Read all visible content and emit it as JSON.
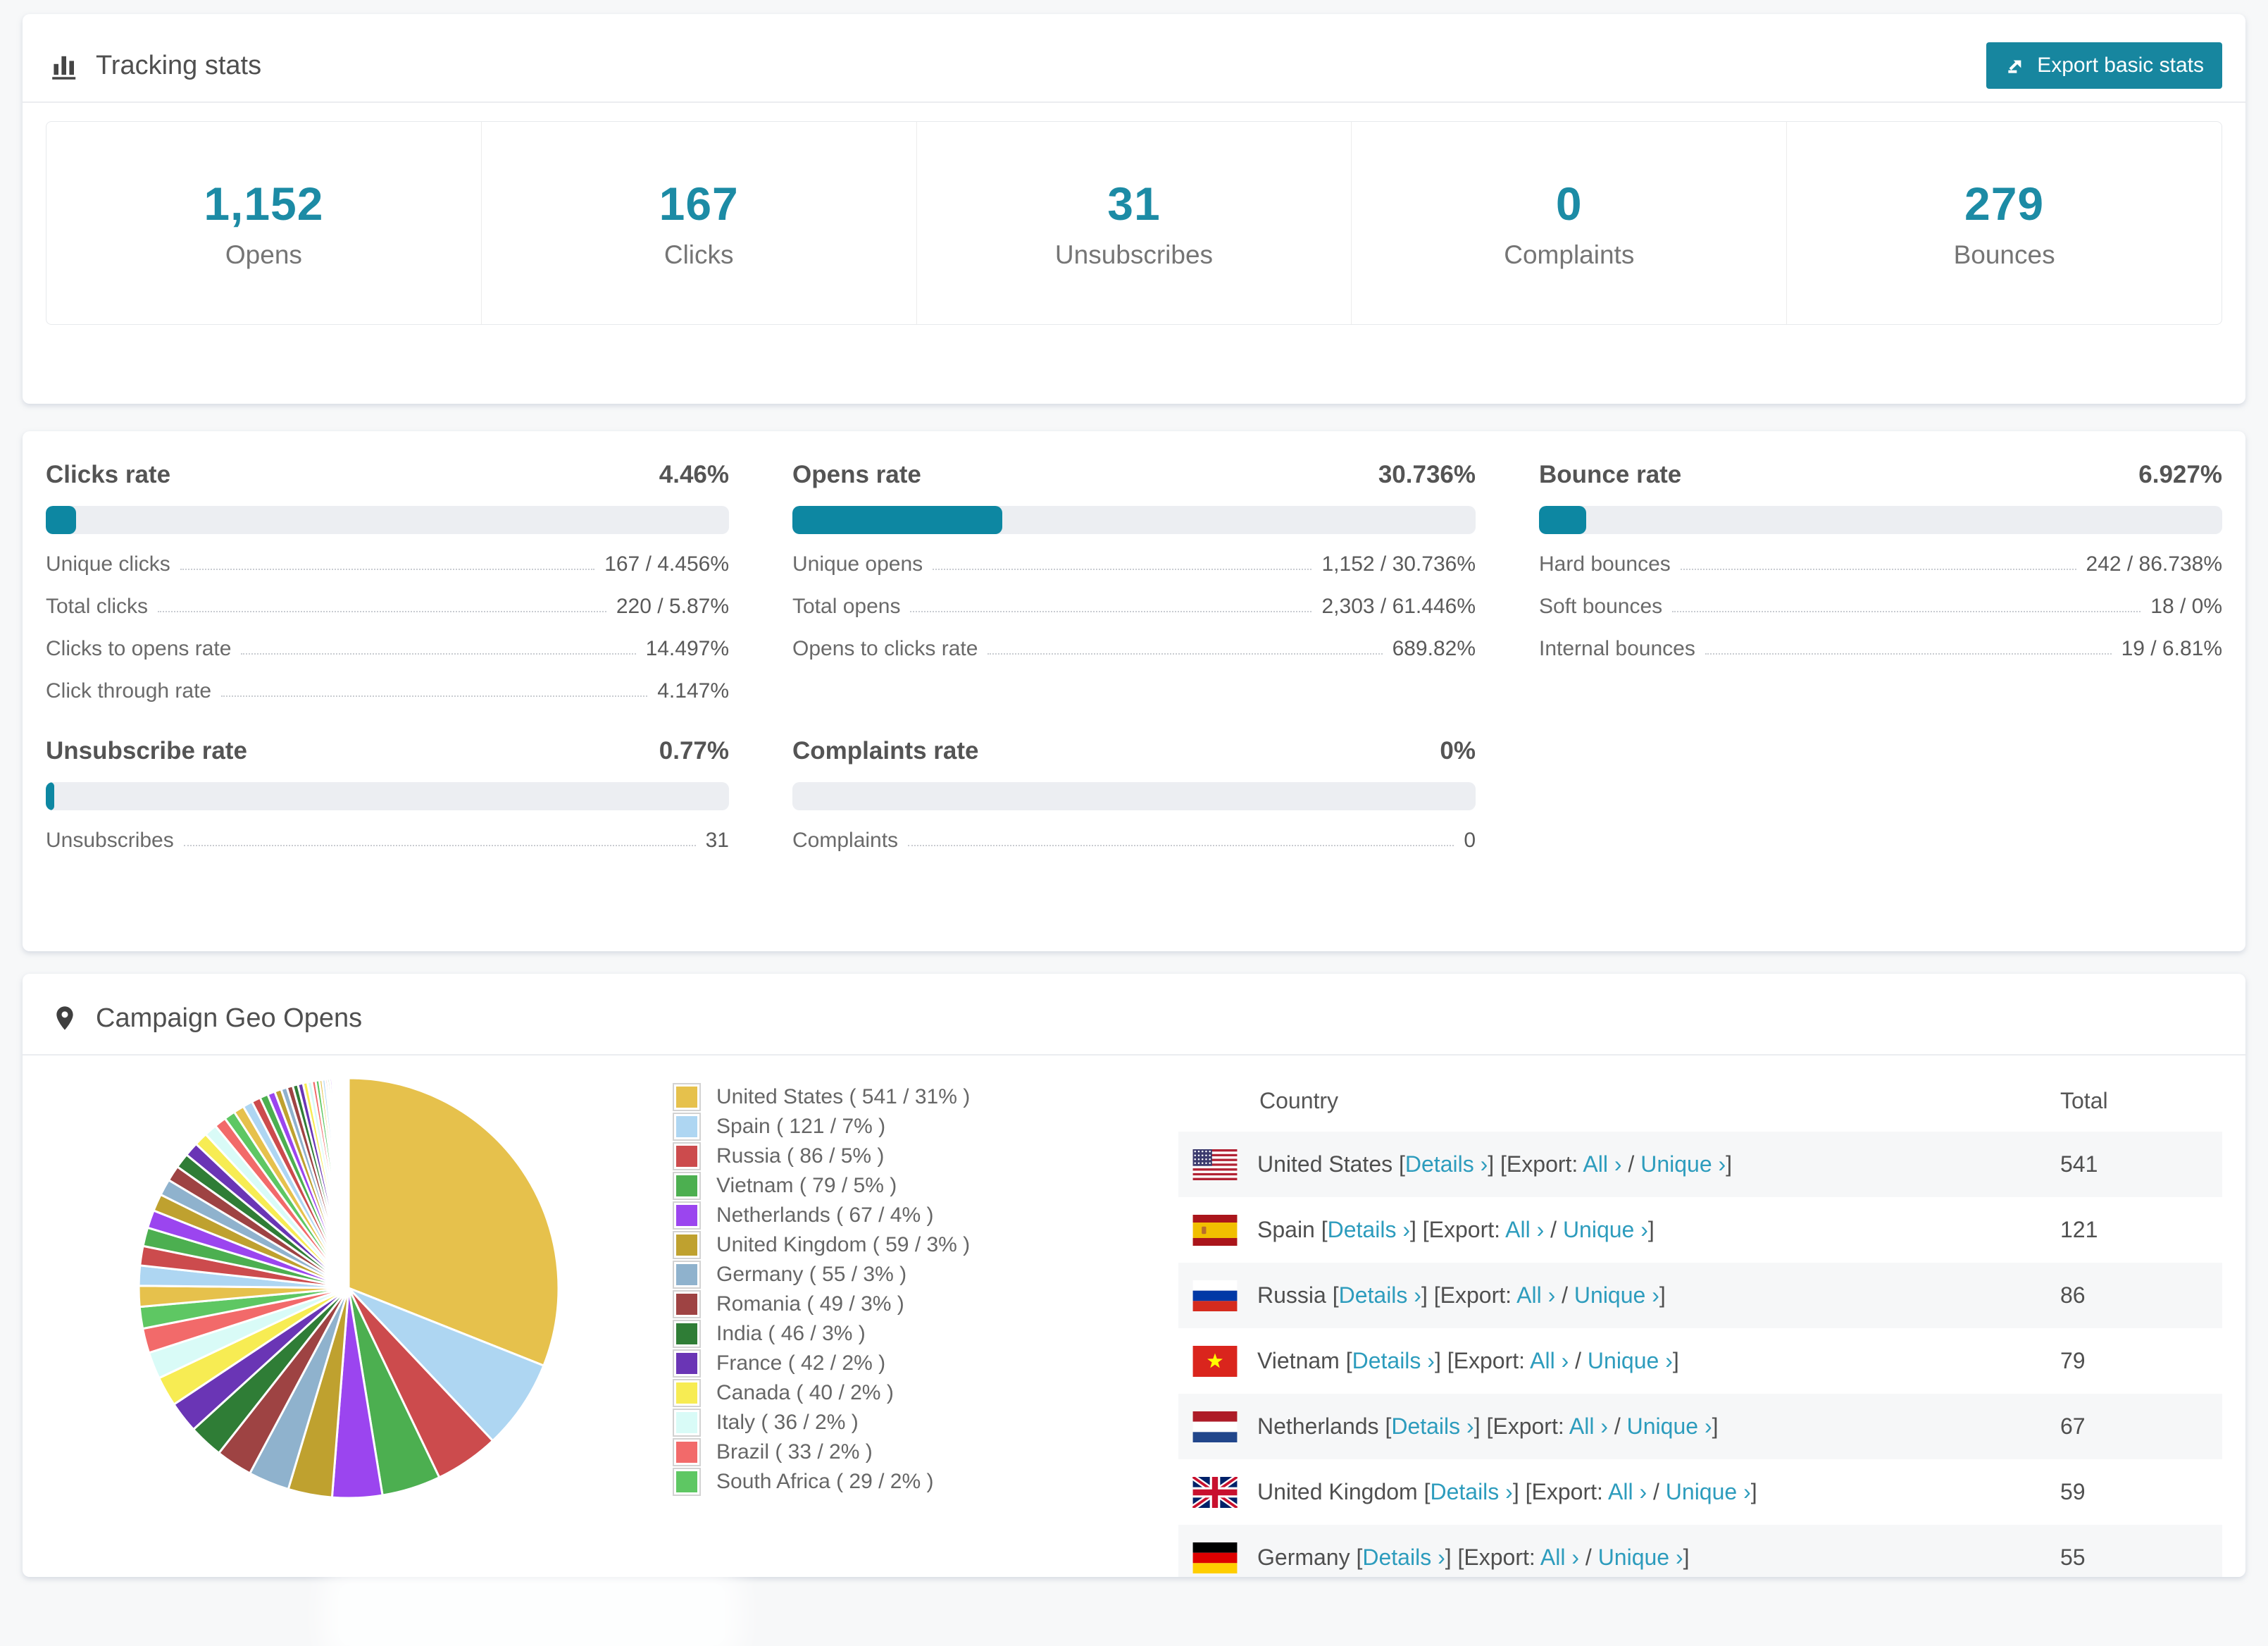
{
  "colors": {
    "accent_button": "#17869f",
    "accent_number": "#1c8ba5",
    "progress_fill": "#0d87a2",
    "progress_track": "#eceef2",
    "link": "#2d9cbd",
    "row_stripe": "#f6f7f8"
  },
  "tracking_stats": {
    "title": "Tracking stats",
    "export_button_label": "Export basic stats",
    "stats": [
      {
        "value": "1,152",
        "label": "Opens"
      },
      {
        "value": "167",
        "label": "Clicks"
      },
      {
        "value": "31",
        "label": "Unsubscribes"
      },
      {
        "value": "0",
        "label": "Complaints"
      },
      {
        "value": "279",
        "label": "Bounces"
      }
    ]
  },
  "rates": {
    "blocks": [
      {
        "title": "Clicks rate",
        "value": "4.46%",
        "percent": 4.46,
        "rows": [
          {
            "label": "Unique clicks",
            "value": "167 / 4.456%"
          },
          {
            "label": "Total clicks",
            "value": "220 / 5.87%"
          },
          {
            "label": "Clicks to opens rate",
            "value": "14.497%"
          },
          {
            "label": "Click through rate",
            "value": "4.147%"
          }
        ]
      },
      {
        "title": "Opens rate",
        "value": "30.736%",
        "percent": 30.736,
        "rows": [
          {
            "label": "Unique opens",
            "value": "1,152 / 30.736%"
          },
          {
            "label": "Total opens",
            "value": "2,303 / 61.446%"
          },
          {
            "label": "Opens to clicks rate",
            "value": "689.82%"
          }
        ]
      },
      {
        "title": "Bounce rate",
        "value": "6.927%",
        "percent": 6.927,
        "rows": [
          {
            "label": "Hard bounces",
            "value": "242 / 86.738%"
          },
          {
            "label": "Soft bounces",
            "value": "18 / 0%"
          },
          {
            "label": "Internal bounces",
            "value": "19 / 6.81%"
          }
        ]
      },
      {
        "title": "Unsubscribe rate",
        "value": "0.77%",
        "percent": 0.77,
        "rows": [
          {
            "label": "Unsubscribes",
            "value": "31"
          }
        ]
      },
      {
        "title": "Complaints rate",
        "value": "0%",
        "percent": 0,
        "rows": [
          {
            "label": "Complaints",
            "value": "0"
          }
        ]
      }
    ]
  },
  "geo": {
    "title": "Campaign Geo Opens",
    "link_labels": {
      "details": "Details ›",
      "export_prefix": "Export:",
      "all": "All ›",
      "unique": "Unique ›"
    },
    "table": {
      "headers": [
        "Country",
        "Total"
      ],
      "rows": [
        {
          "flag": "us",
          "country": "United States",
          "total": "541"
        },
        {
          "flag": "es",
          "country": "Spain",
          "total": "121"
        },
        {
          "flag": "ru",
          "country": "Russia",
          "total": "86"
        },
        {
          "flag": "vn",
          "country": "Vietnam",
          "total": "79"
        },
        {
          "flag": "nl",
          "country": "Netherlands",
          "total": "67"
        },
        {
          "flag": "gb",
          "country": "United Kingdom",
          "total": "59"
        },
        {
          "flag": "de",
          "country": "Germany",
          "total": "55"
        }
      ]
    }
  },
  "chart_data": {
    "type": "pie",
    "title": "Campaign Geo Opens",
    "legend_position": "right",
    "start_angle_deg": -90,
    "direction": "clockwise",
    "series": [
      {
        "name": "United States",
        "value": 541,
        "pct": 31,
        "color": "#e6c14c"
      },
      {
        "name": "Spain",
        "value": 121,
        "pct": 7,
        "color": "#aed6f2"
      },
      {
        "name": "Russia",
        "value": 86,
        "pct": 5,
        "color": "#cc4b4d"
      },
      {
        "name": "Vietnam",
        "value": 79,
        "pct": 5,
        "color": "#4caf50"
      },
      {
        "name": "Netherlands",
        "value": 67,
        "pct": 4,
        "color": "#9b45ef"
      },
      {
        "name": "United Kingdom",
        "value": 59,
        "pct": 3,
        "color": "#bfa12f"
      },
      {
        "name": "Germany",
        "value": 55,
        "pct": 3,
        "color": "#8fb2cd"
      },
      {
        "name": "Romania",
        "value": 49,
        "pct": 3,
        "color": "#9e4343"
      },
      {
        "name": "India",
        "value": 46,
        "pct": 3,
        "color": "#2f7d36"
      },
      {
        "name": "France",
        "value": 42,
        "pct": 2,
        "color": "#6a35b5"
      },
      {
        "name": "Canada",
        "value": 40,
        "pct": 2,
        "color": "#f7ec53"
      },
      {
        "name": "Italy",
        "value": 36,
        "pct": 2,
        "color": "#d9fbf7"
      },
      {
        "name": "Brazil",
        "value": 33,
        "pct": 2,
        "color": "#f26a6a"
      },
      {
        "name": "South Africa",
        "value": 29,
        "pct": 2,
        "color": "#5ec763"
      }
    ],
    "others_values": [
      28,
      27,
      26,
      25,
      24,
      23,
      22,
      21,
      20,
      19,
      18,
      17,
      16,
      15,
      14,
      13,
      12,
      11,
      10,
      9,
      8,
      8,
      7,
      7,
      6,
      6,
      5,
      5,
      4,
      4,
      3,
      3,
      3,
      2,
      2,
      2,
      2,
      2,
      1,
      1,
      1,
      1,
      1,
      1,
      1,
      1,
      1,
      1,
      1,
      1
    ]
  }
}
